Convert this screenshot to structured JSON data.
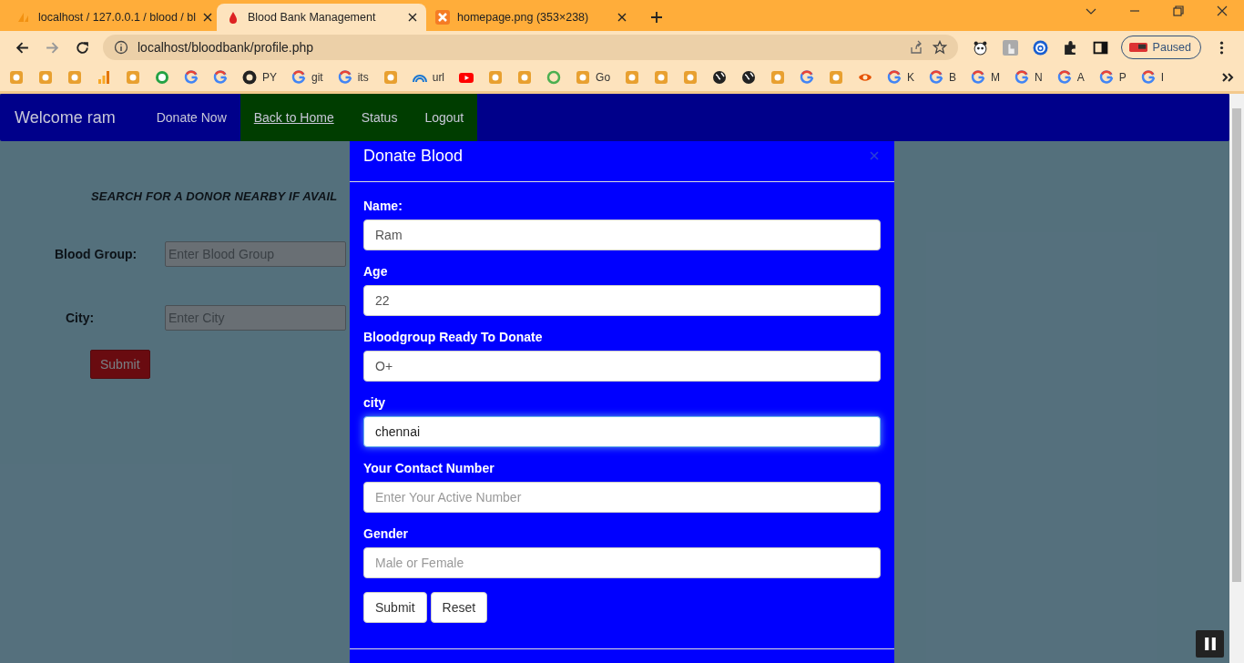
{
  "browser": {
    "tabs": [
      {
        "title": "localhost / 127.0.0.1 / blood / bl",
        "kind": "pma",
        "selected": false
      },
      {
        "title": "Blood Bank Management",
        "kind": "blood",
        "selected": true
      },
      {
        "title": "homepage.png (353×238)",
        "kind": "xampp",
        "selected": false
      }
    ],
    "url": "localhost/bloodbank/profile.php",
    "profile_status": "Paused",
    "bookmarks": [
      {
        "kind": "site"
      },
      {
        "kind": "site"
      },
      {
        "kind": "site"
      },
      {
        "kind": "chart"
      },
      {
        "kind": "site"
      },
      {
        "kind": "chat"
      },
      {
        "kind": "google"
      },
      {
        "kind": "google"
      },
      {
        "kind": "github",
        "label": "PY"
      },
      {
        "kind": "google",
        "label": "git"
      },
      {
        "kind": "google",
        "label": "its"
      },
      {
        "kind": "site"
      },
      {
        "kind": "wifi",
        "label": "url"
      },
      {
        "kind": "play"
      },
      {
        "kind": "site"
      },
      {
        "kind": "site"
      },
      {
        "kind": "ring"
      },
      {
        "kind": "site",
        "label": "Go"
      },
      {
        "kind": "site"
      },
      {
        "kind": "site"
      },
      {
        "kind": "site"
      },
      {
        "kind": "globe"
      },
      {
        "kind": "globe"
      },
      {
        "kind": "site"
      },
      {
        "kind": "google"
      },
      {
        "kind": "site"
      },
      {
        "kind": "eye"
      },
      {
        "kind": "google",
        "label": "K"
      },
      {
        "kind": "google",
        "label": "B"
      },
      {
        "kind": "google",
        "label": "M"
      },
      {
        "kind": "google",
        "label": "N"
      },
      {
        "kind": "google",
        "label": "A"
      },
      {
        "kind": "google",
        "label": "P"
      },
      {
        "kind": "google",
        "label": "I"
      }
    ]
  },
  "navbar": {
    "brand": "Welcome ram",
    "links": [
      {
        "label": "Donate Now",
        "highlighted": false,
        "underlined": false
      },
      {
        "label": "Back to Home",
        "highlighted": true,
        "underlined": true
      },
      {
        "label": "Status",
        "highlighted": true,
        "underlined": false
      },
      {
        "label": "Logout",
        "highlighted": true,
        "underlined": false
      }
    ]
  },
  "search": {
    "heading": "SEARCH FOR A DONOR NEARBY IF AVAIL",
    "fields": [
      {
        "label": "Blood Group:",
        "placeholder": "Enter Blood Group"
      },
      {
        "label": "City:",
        "placeholder": "Enter City"
      }
    ],
    "submit": "Submit"
  },
  "modal": {
    "title": "Donate Blood",
    "fields": [
      {
        "label": "Name:",
        "value": "Ram",
        "focused": false
      },
      {
        "label": "Age",
        "value": "22",
        "focused": false
      },
      {
        "label": "Bloodgroup Ready To Donate",
        "value": "O+",
        "focused": false
      },
      {
        "label": "city",
        "value": "chennai",
        "focused": true
      },
      {
        "label": "Your Contact Number",
        "placeholder": "Enter Your Active Number",
        "focused": false
      },
      {
        "label": "Gender",
        "placeholder": "Male or Female",
        "focused": false
      }
    ],
    "buttons": [
      "Submit",
      "Reset"
    ]
  }
}
